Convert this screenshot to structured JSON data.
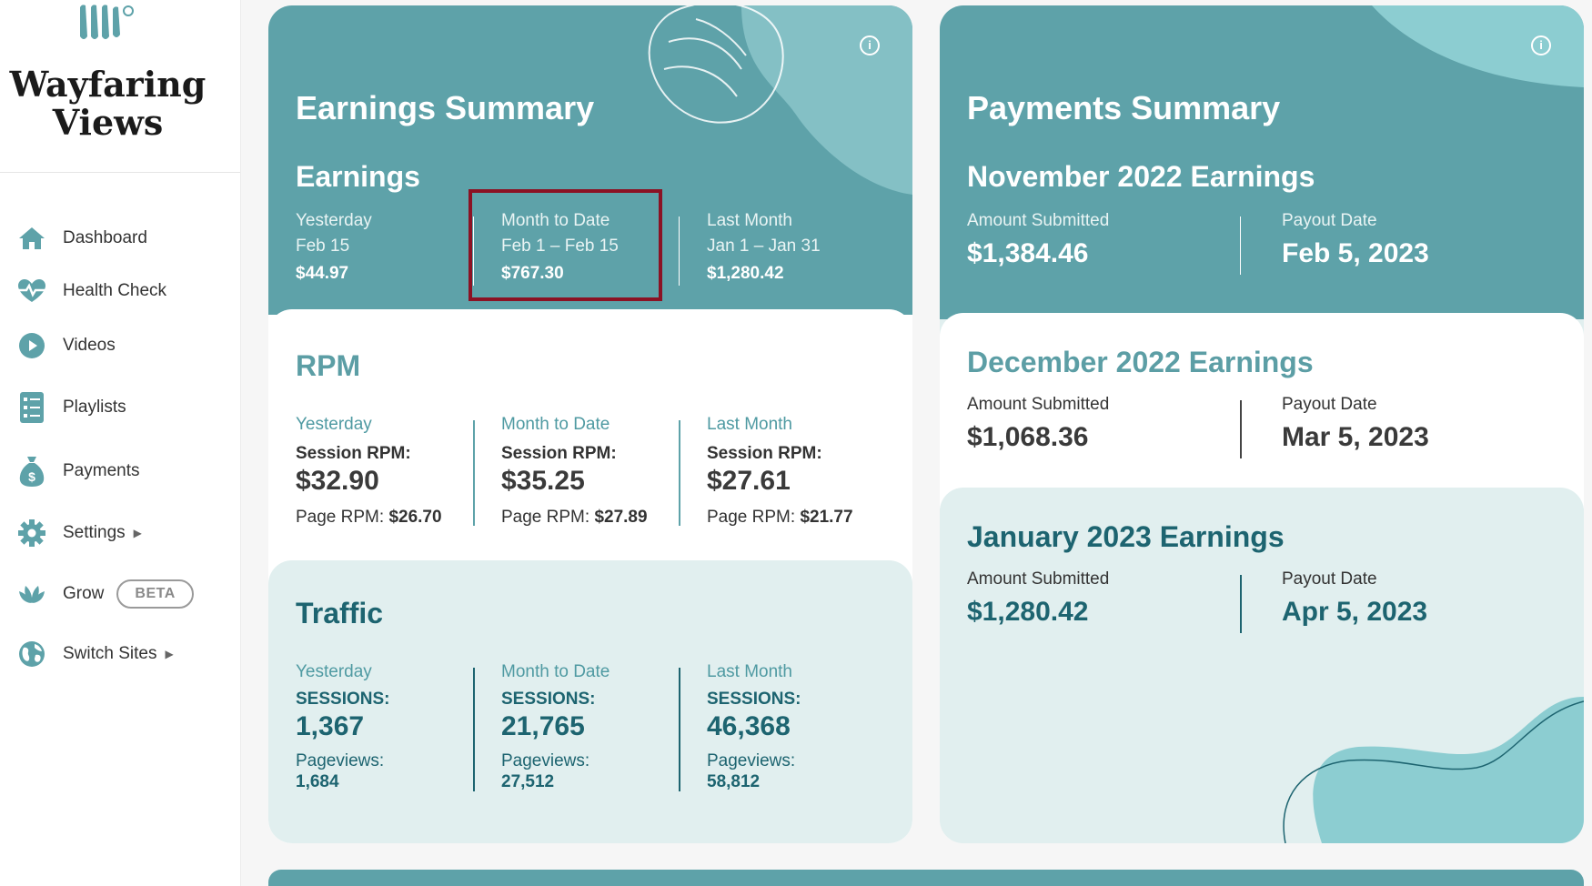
{
  "brand": {
    "name_line1": "Wayfaring",
    "name_line2": "Views"
  },
  "nav": {
    "items": [
      {
        "label": "Dashboard",
        "icon": "home-icon"
      },
      {
        "label": "Health Check",
        "icon": "heartbeat-icon"
      },
      {
        "label": "Videos",
        "icon": "play-icon"
      },
      {
        "label": "Playlists",
        "icon": "list-icon"
      },
      {
        "label": "Payments",
        "icon": "money-bag-icon"
      },
      {
        "label": "Settings",
        "icon": "gear-icon"
      },
      {
        "label": "Grow",
        "icon": "leaf-icon",
        "badge": "BETA"
      },
      {
        "label": "Switch Sites",
        "icon": "globe-icon"
      }
    ]
  },
  "earnings": {
    "title": "Earnings Summary",
    "subtitle": "Earnings",
    "cols": [
      {
        "label": "Yesterday",
        "range": "Feb 15",
        "value": "$44.97"
      },
      {
        "label": "Month to Date",
        "range": "Feb 1 – Feb 15",
        "value": "$767.30"
      },
      {
        "label": "Last Month",
        "range": "Jan 1 – Jan 31",
        "value": "$1,280.42"
      }
    ]
  },
  "rpm": {
    "title": "RPM",
    "session_label": "Session RPM:",
    "page_label": "Page RPM:",
    "cols": [
      {
        "label": "Yesterday",
        "session": "$32.90",
        "page": "$26.70"
      },
      {
        "label": "Month to Date",
        "session": "$35.25",
        "page": "$27.89"
      },
      {
        "label": "Last Month",
        "session": "$27.61",
        "page": "$21.77"
      }
    ]
  },
  "traffic": {
    "title": "Traffic",
    "sessions_label": "SESSIONS:",
    "pageviews_label": "Pageviews:",
    "cols": [
      {
        "label": "Yesterday",
        "sessions": "1,367",
        "pageviews": "1,684"
      },
      {
        "label": "Month to Date",
        "sessions": "21,765",
        "pageviews": "27,512"
      },
      {
        "label": "Last Month",
        "sessions": "46,368",
        "pageviews": "58,812"
      }
    ]
  },
  "payments": {
    "title": "Payments Summary",
    "amount_label": "Amount Submitted",
    "payout_label": "Payout Date",
    "periods": [
      {
        "heading": "November 2022 Earnings",
        "amount": "$1,384.46",
        "payout": "Feb 5, 2023"
      },
      {
        "heading": "December 2022 Earnings",
        "amount": "$1,068.36",
        "payout": "Mar 5, 2023"
      },
      {
        "heading": "January 2023 Earnings",
        "amount": "$1,280.42",
        "payout": "Apr 5, 2023"
      }
    ]
  },
  "colors": {
    "teal": "#5ea2a9",
    "light_teal": "#e1efef",
    "navy": "#1d6470",
    "highlight": "#8b1224"
  }
}
